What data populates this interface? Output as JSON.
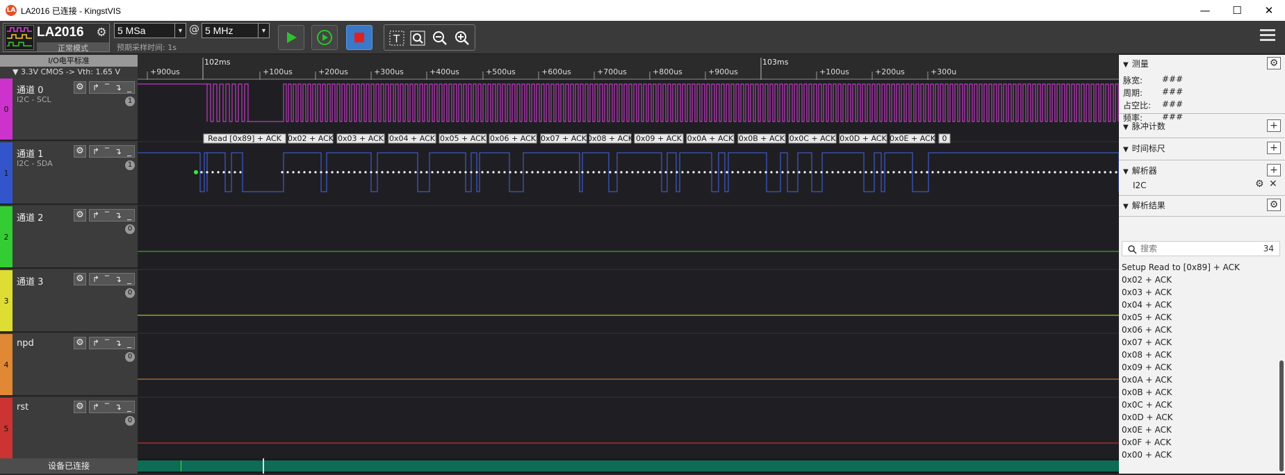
{
  "window": {
    "title": "LA2016 已连接 - KingstVIS",
    "logo": "LA"
  },
  "toolbar": {
    "device_name": "LA2016",
    "device_mode": "正常模式",
    "sample_depth": "5 MSa",
    "at": "@",
    "sample_rate": "5 MHz",
    "sample_time": "预期采样时间: 1s"
  },
  "io": {
    "header": "I/O电平标准",
    "standard": "▼  3.3V CMOS   -> Vth: 1.65 V"
  },
  "channels": [
    {
      "index": "0",
      "name": "通道 0",
      "protocol": "I2C - SCL",
      "count": "1",
      "color": "#cc33cc",
      "trace": "#e040e0"
    },
    {
      "index": "1",
      "name": "通道 1",
      "protocol": "I2C - SDA",
      "count": "1",
      "color": "#3355cc",
      "trace": "#4466ee"
    },
    {
      "index": "2",
      "name": "通道 2",
      "protocol": "",
      "count": "0",
      "color": "#33cc33",
      "trace": "#33cc33"
    },
    {
      "index": "3",
      "name": "通道 3",
      "protocol": "",
      "count": "0",
      "color": "#dddd33",
      "trace": "#dddd33"
    },
    {
      "index": "4",
      "name": "npd",
      "protocol": "",
      "count": "0",
      "color": "#e08833",
      "trace": "#e08833"
    },
    {
      "index": "5",
      "name": "rst",
      "protocol": "",
      "count": "0",
      "color": "#cc3333",
      "trace": "#ee3333"
    }
  ],
  "timeline": {
    "major": [
      {
        "label": "102ms"
      },
      {
        "label": "103ms"
      }
    ],
    "minor": [
      "+900us",
      "+100us",
      "+200us",
      "+300us",
      "+400us",
      "+500us",
      "+600us",
      "+700us",
      "+800us",
      "+900us",
      "+100us",
      "+200us",
      "+300u"
    ]
  },
  "decode_labels": [
    "Read [0x89] + ACK",
    "0x02 + ACK",
    "0x03 + ACK",
    "0x04 + ACK",
    "0x05 + ACK",
    "0x06 + ACK",
    "0x07 + ACK",
    "0x08 + ACK",
    "0x09 + ACK",
    "0x0A + ACK",
    "0x0B + ACK",
    "0x0C + ACK",
    "0x0D + ACK",
    "0x0E + ACK",
    "0"
  ],
  "status": {
    "left": "设备已连接"
  },
  "right_panel": {
    "measure_title": "测量",
    "measurements": [
      {
        "label": "脉宽:",
        "value": "###"
      },
      {
        "label": "周期:",
        "value": "###"
      },
      {
        "label": "占空比:",
        "value": "###"
      },
      {
        "label": "频率:",
        "value": "###"
      }
    ],
    "pulse_count": "脉冲计数",
    "time_ruler": "时间标尺",
    "analyzer": "解析器",
    "analyzer_item": "I2C",
    "results_title": "解析结果",
    "search_placeholder": "搜索",
    "results_count": "34",
    "results": [
      "Setup Read to [0x89] + ACK",
      "0x02 + ACK",
      "0x03 + ACK",
      "0x04 + ACK",
      "0x05 + ACK",
      "0x06 + ACK",
      "0x07 + ACK",
      "0x08 + ACK",
      "0x09 + ACK",
      "0x0A + ACK",
      "0x0B + ACK",
      "0x0C + ACK",
      "0x0D + ACK",
      "0x0E + ACK",
      "0x0F + ACK",
      "0x00 + ACK"
    ]
  }
}
